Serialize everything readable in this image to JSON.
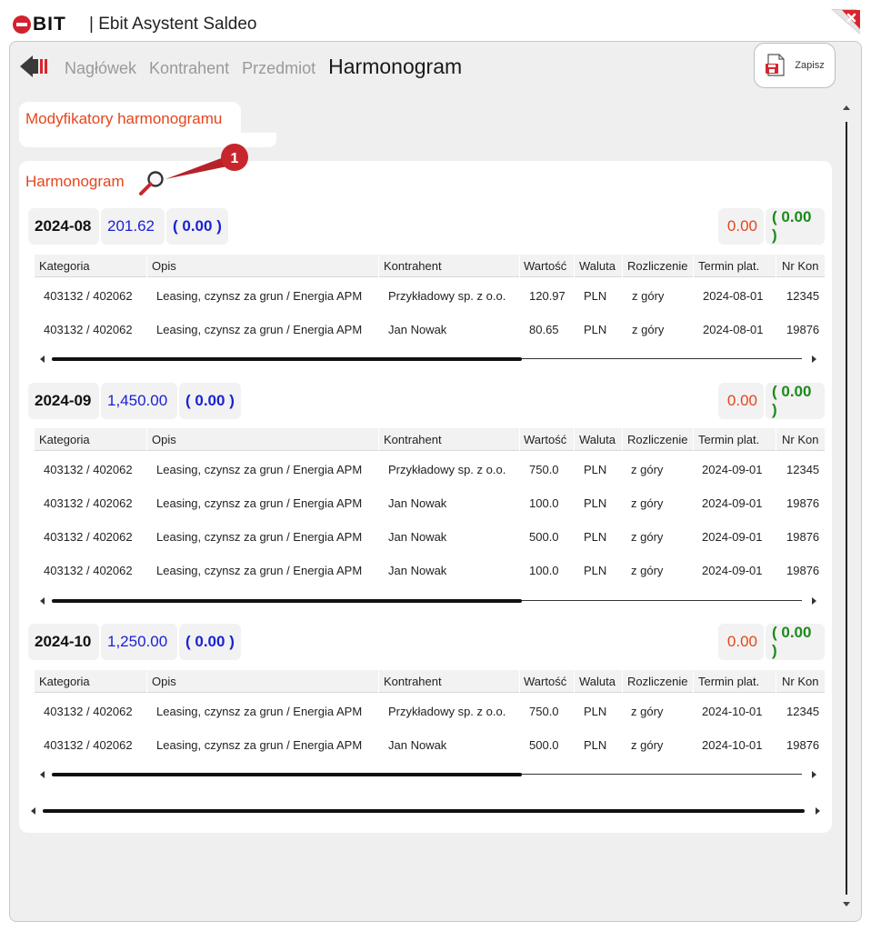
{
  "app": {
    "logo_text": "BIT",
    "title": "| Ebit Asystent Saldeo"
  },
  "nav": {
    "steps": [
      "Nagłówek",
      "Kontrahent",
      "Przedmiot"
    ],
    "active_step": "Harmonogram",
    "save_label": "Zapisz"
  },
  "modifiers": {
    "title": "Modyfikatory harmonogramu"
  },
  "harmonogram": {
    "title": "Harmonogram",
    "callout_number": "1",
    "columns": [
      "Kategoria",
      "Opis",
      "Kontrahent",
      "Wartość",
      "Waluta",
      "Rozliczenie",
      "Termin plat.",
      "Nr Kon"
    ],
    "sections": [
      {
        "month": "2024-08",
        "sum": "201.62",
        "paren": "( 0.00 )",
        "right_sum": "0.00",
        "right_paren": "( 0.00 )",
        "rows": [
          [
            "403132 / 402062",
            "Leasing, czynsz za grun / Energia APM",
            "Przykładowy sp. z o.o.",
            "120.97",
            "PLN",
            "z góry",
            "2024-08-01",
            "12345"
          ],
          [
            "403132 / 402062",
            "Leasing, czynsz za grun / Energia APM",
            "Jan Nowak",
            "80.65",
            "PLN",
            "z góry",
            "2024-08-01",
            "19876"
          ]
        ]
      },
      {
        "month": "2024-09",
        "sum": "1,450.00",
        "paren": "( 0.00 )",
        "right_sum": "0.00",
        "right_paren": "( 0.00 )",
        "rows": [
          [
            "403132 / 402062",
            "Leasing, czynsz za grun / Energia APM",
            "Przykładowy sp. z o.o.",
            "750.0",
            "PLN",
            "z góry",
            "2024-09-01",
            "12345"
          ],
          [
            "403132 / 402062",
            "Leasing, czynsz za grun / Energia APM",
            "Jan Nowak",
            "100.0",
            "PLN",
            "z góry",
            "2024-09-01",
            "19876"
          ],
          [
            "403132 / 402062",
            "Leasing, czynsz za grun / Energia APM",
            "Jan Nowak",
            "500.0",
            "PLN",
            "z góry",
            "2024-09-01",
            "19876"
          ],
          [
            "403132 / 402062",
            "Leasing, czynsz za grun / Energia APM",
            "Jan Nowak",
            "100.0",
            "PLN",
            "z góry",
            "2024-09-01",
            "19876"
          ]
        ]
      },
      {
        "month": "2024-10",
        "sum": "1,250.00",
        "paren": "( 0.00 )",
        "right_sum": "0.00",
        "right_paren": "( 0.00 )",
        "rows": [
          [
            "403132 / 402062",
            "Leasing, czynsz za grun / Energia APM",
            "Przykładowy sp. z o.o.",
            "750.0",
            "PLN",
            "z góry",
            "2024-10-01",
            "12345"
          ],
          [
            "403132 / 402062",
            "Leasing, czynsz za grun / Energia APM",
            "Jan Nowak",
            "500.0",
            "PLN",
            "z góry",
            "2024-10-01",
            "19876"
          ]
        ]
      }
    ]
  },
  "icons": {
    "back": "arrow-left-icon",
    "close": "close-icon",
    "save": "save-pdf-icon",
    "search": "search-icon"
  },
  "colors": {
    "accent_orange": "#e4461c",
    "sum_blue": "#1a22d4",
    "ok_green": "#1c8a1c",
    "brand_red": "#d0232f"
  }
}
